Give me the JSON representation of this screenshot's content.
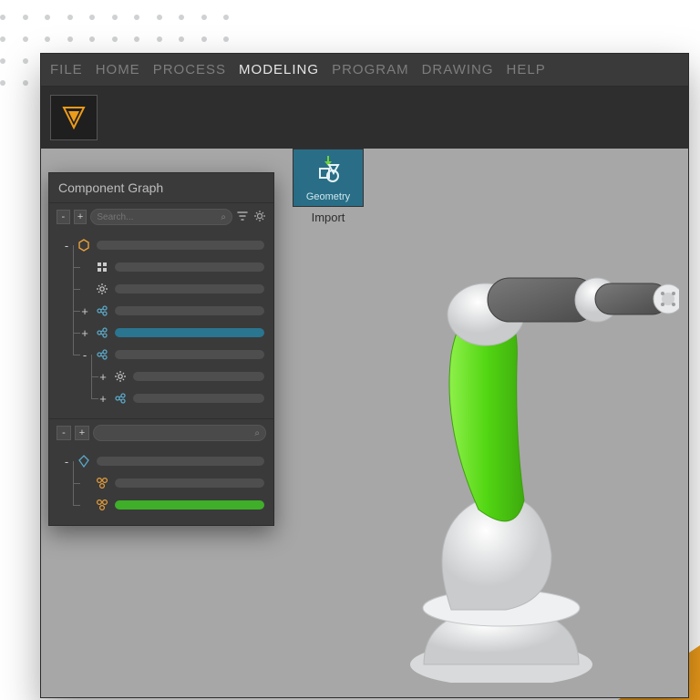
{
  "menubar": {
    "items": [
      {
        "label": "FILE"
      },
      {
        "label": "HOME"
      },
      {
        "label": "PROCESS"
      },
      {
        "label": "MODELING"
      },
      {
        "label": "PROGRAM"
      },
      {
        "label": "DRAWING"
      },
      {
        "label": "HELP"
      }
    ],
    "active_index": 3
  },
  "ribbon": {
    "geometry_label": "Geometry",
    "import_label": "Import"
  },
  "panel": {
    "title": "Component Graph",
    "collapse_symbol": "-",
    "expand_symbol": "+",
    "search_placeholder": "Search...",
    "section1": {
      "rows": [
        {
          "exp": "-",
          "level": 1,
          "icon": "component-icon",
          "color": "#e9a03c"
        },
        {
          "exp": "",
          "level": 2,
          "icon": "feature-icon",
          "color": "#cccccc"
        },
        {
          "exp": "",
          "level": 2,
          "icon": "settings-icon",
          "color": "#cccccc"
        },
        {
          "exp": "+",
          "level": 2,
          "icon": "link-icon",
          "color": "#5aa8c7"
        },
        {
          "exp": "+",
          "level": 2,
          "icon": "link-icon",
          "color": "#5aa8c7",
          "selected": true
        },
        {
          "exp": "-",
          "level": 2,
          "icon": "link-icon",
          "color": "#5aa8c7"
        },
        {
          "exp": "+",
          "level": 3,
          "icon": "settings-icon",
          "color": "#cccccc"
        },
        {
          "exp": "+",
          "level": 3,
          "icon": "link-icon",
          "color": "#5aa8c7"
        }
      ]
    },
    "section2": {
      "rows": [
        {
          "exp": "-",
          "level": 1,
          "icon": "diamond-icon",
          "color": "#5aa8c7"
        },
        {
          "exp": "",
          "level": 2,
          "icon": "mesh-icon",
          "color": "#e9a03c"
        },
        {
          "exp": "",
          "level": 2,
          "icon": "mesh-icon",
          "color": "#e9a03c",
          "green": true
        }
      ]
    }
  },
  "colors": {
    "accent_orange": "#ed9b1a",
    "accent_green": "#5cd62a",
    "accent_teal": "#296e86"
  }
}
